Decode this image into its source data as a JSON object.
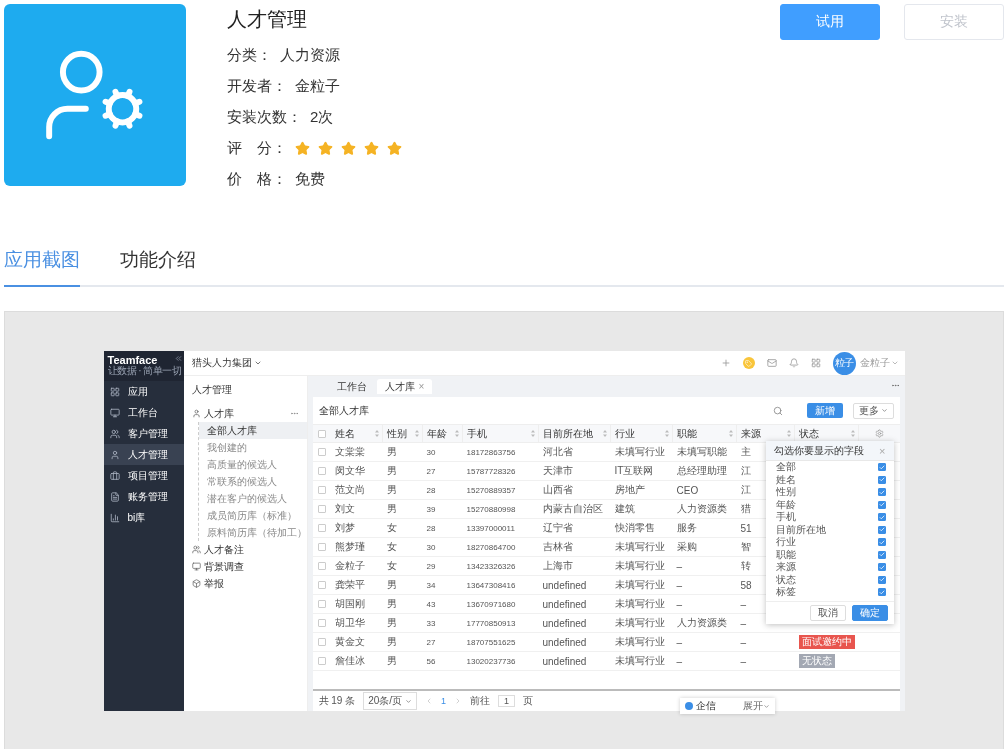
{
  "app": {
    "title": "人才管理",
    "info": [
      {
        "kind": "text",
        "label": "分类：",
        "value": "人力资源"
      },
      {
        "kind": "text",
        "label": "开发者：",
        "value": "金粒子"
      },
      {
        "kind": "text",
        "label": "安装次数：",
        "value": "2次"
      },
      {
        "kind": "stars",
        "label": "评　分：",
        "stars": 5
      },
      {
        "kind": "text",
        "label": "价　格：",
        "value": "免费"
      }
    ],
    "buttons": [
      {
        "label": "试用",
        "disabled": false
      },
      {
        "label": "安装",
        "disabled": true
      }
    ]
  },
  "tabs": [
    {
      "label": "应用截图",
      "selected": true
    },
    {
      "label": "功能介绍",
      "selected": false
    }
  ],
  "screenshot": {
    "brand": {
      "name": "Teamface",
      "slogan": "让数据 · 简单一切"
    },
    "company": "猎头人力集团",
    "user": {
      "avatar": "粒子",
      "name": "金粒子"
    },
    "nav": [
      {
        "label": "应用",
        "selected": false
      },
      {
        "label": "工作台",
        "selected": false
      },
      {
        "label": "客户管理",
        "selected": false
      },
      {
        "label": "人才管理",
        "selected": true
      },
      {
        "label": "项目管理",
        "selected": false
      },
      {
        "label": "账务管理",
        "selected": false
      },
      {
        "label": "bi库",
        "selected": false
      }
    ],
    "tree": {
      "title": "人才管理",
      "groups": [
        {
          "label": "人才库",
          "children": [
            {
              "label": "全部人才库",
              "selected": true
            },
            {
              "label": "我创建的",
              "selected": false
            },
            {
              "label": "高质量的候选人",
              "selected": false
            },
            {
              "label": "常联系的候选人",
              "selected": false
            },
            {
              "label": "潜在客户的候选人",
              "selected": false
            },
            {
              "label": "成员简历库（标准）",
              "selected": false
            },
            {
              "label": "原料简历库（待加工）",
              "selected": false
            }
          ]
        },
        {
          "label": "人才备注"
        },
        {
          "label": "背景调查"
        },
        {
          "label": "举报"
        }
      ]
    },
    "tabs": [
      {
        "label": "工作台",
        "selected": false
      },
      {
        "label": "人才库",
        "selected": true,
        "close": "×"
      }
    ],
    "view_title": "全部人才库",
    "new_button": "新增",
    "more_button": "更多",
    "select_all": {
      "checked": false
    },
    "columns": [
      "姓名",
      "性别",
      "年龄",
      "手机",
      "目前所在地",
      "行业",
      "职能",
      "来源",
      "状态"
    ],
    "rows": [
      {
        "checked": false,
        "cells": [
          "文棠棠",
          "男",
          "30",
          "18172863756",
          "河北省",
          "未填写行业",
          "未填写职能",
          "主"
        ]
      },
      {
        "checked": false,
        "cells": [
          "闵文华",
          "男",
          "27",
          "15787728326",
          "天津市",
          "IT互联网",
          "总经理助理",
          "江"
        ]
      },
      {
        "checked": false,
        "cells": [
          "范文尚",
          "男",
          "28",
          "15270889357",
          "山西省",
          "房地产",
          "CEO",
          "江"
        ]
      },
      {
        "checked": false,
        "cells": [
          "刘文",
          "男",
          "39",
          "15270880998",
          "内蒙古自治区",
          "建筑",
          "人力资源类",
          "猎"
        ]
      },
      {
        "checked": false,
        "cells": [
          "刘梦",
          "女",
          "28",
          "13397000011",
          "辽宁省",
          "快消零售",
          "服务",
          "51"
        ]
      },
      {
        "checked": false,
        "cells": [
          "熊梦瑾",
          "女",
          "30",
          "18270864700",
          "吉林省",
          "未填写行业",
          "采购",
          "智"
        ]
      },
      {
        "checked": false,
        "cells": [
          "金粒子",
          "女",
          "29",
          "13423326326",
          "上海市",
          "未填写行业",
          "–",
          "转"
        ]
      },
      {
        "checked": false,
        "cells": [
          "龚荣平",
          "男",
          "34",
          "13647308416",
          "undefined",
          "未填写行业",
          "–",
          "58"
        ]
      },
      {
        "checked": false,
        "cells": [
          "胡国刚",
          "男",
          "43",
          "13670971680",
          "undefined",
          "未填写行业",
          "–",
          "–"
        ]
      },
      {
        "checked": false,
        "cells": [
          "胡卫华",
          "男",
          "33",
          "17770850913",
          "undefined",
          "未填写行业",
          "人力资源类",
          "–"
        ]
      },
      {
        "checked": false,
        "cells": [
          "黄金文",
          "男",
          "27",
          "18707551625",
          "undefined",
          "未填写行业",
          "–",
          "–"
        ],
        "status": {
          "label": "面试邀约中",
          "color": "#e8554e"
        }
      },
      {
        "checked": false,
        "cells": [
          "詹佳冰",
          "男",
          "56",
          "13020237736",
          "undefined",
          "未填写行业",
          "–",
          "–"
        ],
        "status": {
          "label": "无状态",
          "color": "#a3a8b3"
        }
      }
    ],
    "column_picker": {
      "title": "勾选你要显示的字段",
      "close": "×",
      "fields": [
        {
          "label": "全部",
          "checked": true
        },
        {
          "label": "姓名",
          "checked": true
        },
        {
          "label": "性别",
          "checked": true
        },
        {
          "label": "年龄",
          "checked": true
        },
        {
          "label": "手机",
          "checked": true
        },
        {
          "label": "目前所在地",
          "checked": true
        },
        {
          "label": "行业",
          "checked": true
        },
        {
          "label": "职能",
          "checked": true
        },
        {
          "label": "来源",
          "checked": true
        },
        {
          "label": "状态",
          "checked": true
        },
        {
          "label": "标签",
          "checked": true
        }
      ],
      "buttons": [
        "取消",
        "确定"
      ]
    },
    "pagination": {
      "total": "共 19 条",
      "page_size": "20条/页",
      "current": "1",
      "goto_label": "前往",
      "goto_value": "1",
      "goto_suffix": "页"
    },
    "chat": {
      "label": "企信",
      "action": "展开"
    }
  }
}
